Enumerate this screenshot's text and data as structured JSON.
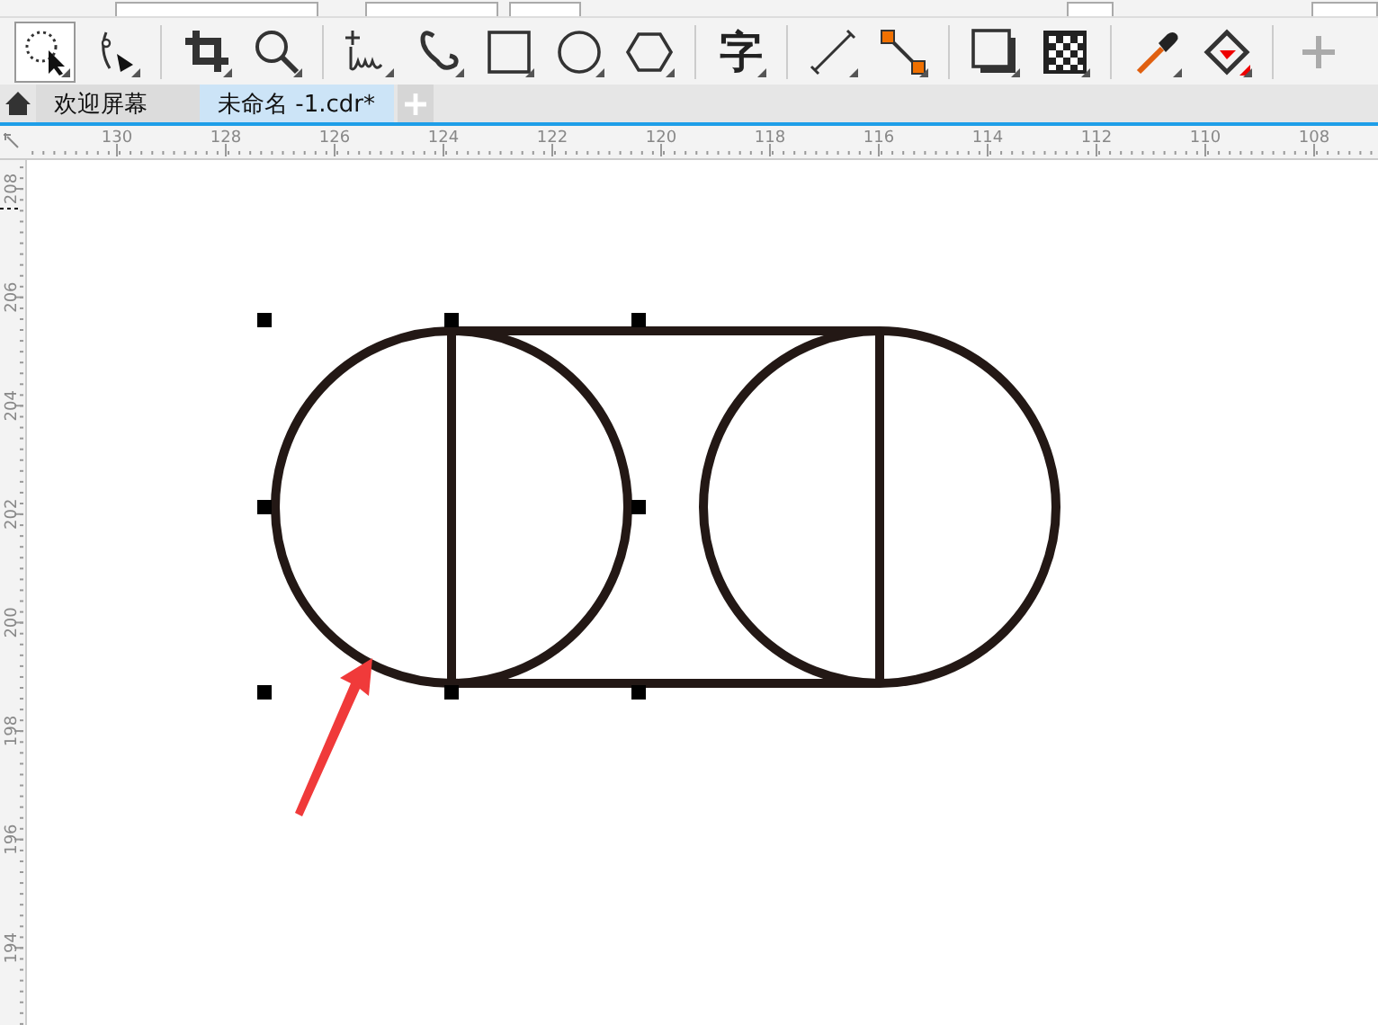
{
  "toolbar": {
    "tools": [
      {
        "kind": "pick",
        "selected": true
      },
      {
        "kind": "shape",
        "selected": false
      },
      {
        "kind": "separator"
      },
      {
        "kind": "crop",
        "selected": false
      },
      {
        "kind": "zoom",
        "selected": false
      },
      {
        "kind": "separator"
      },
      {
        "kind": "freehand",
        "selected": false
      },
      {
        "kind": "artistic",
        "selected": false
      },
      {
        "kind": "rectangle",
        "selected": false
      },
      {
        "kind": "ellipse",
        "selected": false
      },
      {
        "kind": "polygon",
        "selected": false
      },
      {
        "kind": "separator"
      },
      {
        "kind": "text",
        "label": "字",
        "selected": false
      },
      {
        "kind": "separator"
      },
      {
        "kind": "dimension",
        "selected": false
      },
      {
        "kind": "connector",
        "selected": false
      },
      {
        "kind": "separator"
      },
      {
        "kind": "shadow",
        "selected": false
      },
      {
        "kind": "transparency",
        "selected": false
      },
      {
        "kind": "separator"
      },
      {
        "kind": "eyedropper",
        "selected": false
      },
      {
        "kind": "fill",
        "selected": false
      },
      {
        "kind": "separator"
      },
      {
        "kind": "add",
        "selected": false
      }
    ]
  },
  "tabs": [
    {
      "label": "欢迎屏幕",
      "selected": false
    },
    {
      "label": "未命名 -1.cdr*",
      "selected": true
    }
  ],
  "ruler_horizontal": {
    "labels": [
      "130",
      "128",
      "126",
      "124",
      "122",
      "120",
      "118",
      "116",
      "114",
      "112",
      "110",
      "108"
    ]
  },
  "ruler_vertical": {
    "labels": [
      "208",
      "206",
      "204",
      "202",
      "200",
      "198",
      "196",
      "194"
    ]
  }
}
